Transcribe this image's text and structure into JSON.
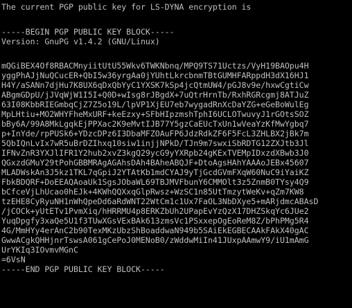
{
  "console": {
    "heading": "The current PGP public key for LS-DYNA encryption is",
    "begin_marker": "-----BEGIN PGP PUBLIC KEY BLOCK-----",
    "version": "Version: GnuPG v1.4.2 (GNU/Linux)",
    "key_lines": [
      "mQGiBEX4Of8RBACMnyiitUtU55Wkv6TWKNbnq/MPQ9TS71Uctzs/VyH19BAOpu4H",
      "yggPhAJjNuQCucER+QbI5w36yrgAa0jYUhtLkrcbnmTBtGUMHFARppdH3dX16HJ1",
      "H4Y/aSANn7djHu7K8UX6qDxQbYyC1YXSK7kSp4jcQtmUW4/pGJ8v9e/hxwCgtiCw",
      "ABgmGDpU/jJVqWjW1I5I+Q0D+wIsg8rJBgdX+7uQtrHrnTb/RxhRGRcgmj8ATJuZ",
      "63I08KbbRIEGmbqCjZ7Z5o19L/lpVP1XjEU7eb7wygadRnXcDaYZG+eGeBoWulEg",
      "MpLHtiu+MO2WHYFheMxURF+keEzxy+SFbHIpzmshTphI6UCLOTwuvyJ1rGOtsSOZ",
      "bBy6A/99A8MkLgqkEjPPXac2K9eMvtIJB77Y5gzCaEUcTxUn1wVeaYzKfMwYgbq7",
      "p+InYde/rpPUSk6+YDzcDPz6I3DbaMFZOAuFP6JdzRdkZF6F5FcL3ZHLBX2jBk7m",
      "5QbIQnLvIx7wR5uBrDZIhxq10siw1injjNPkD/TJn9m7swxiSbRDTG12ZXJtb3Jl",
      "IFNvZnR3YXJlIFR1Y2hub2xvZ3kgQ29ycG9yYXRpb24gKExTVEMpIDxzdXBwb3J0",
      "QGxzdGMuY29tPohGBBMRAgAGAhsDAh4BAheABQJF+DtoAgsHAhYAAAoJEBx45607",
      "MLADWskAn3J5kz1TKL7qGpiJ2YTAtKb1mdCYAJ9yTjGcdGVmFXqW60NuC9iYaiKZ",
      "FbkBDQRF+DoEEAQAoaUk1SgsJObaWL69TBJMVFbunY6CMMOlt3z5ZnmB0TYsy4Q9",
      "bCfceVjLhUcao0hEJk+4KWhQQXxqGlpRwsz+WzSC1n85UtTmzytWeKv+qZm7KW8",
      "tzEHE8CyRyuNH1nWhQpeDd6aRdWNT22WtCm1c1Ux7FaOL3NbDXye5+mARjdmcABAsD",
      "/jCOCk+yUtETv1PvmXiq/hHRRMU4p8ERKZbUh2UPapEvYzQzX17DHZSkqYc6JUe2",
      "YuqDpgfy3xaQe5U1f3TUwXGsVExBAk613zmsVc1PSxxepOgEoReM8Z/bPhPMg5R4",
      "4G/MmHYy4erAnC2b90TexMKzUbzShBoaddwaN949b5SAiEkEGBECAAkFAkX40gAC",
      "GwwACgkQHHjnrTswsA061gCePoJ0MENoB0/zWddwMiIn41JUxpAAmwY9/iU1mAmG",
      "UrYKIq3IOvmvMGnC",
      "=6VsN"
    ],
    "end_marker": "-----END PGP PUBLIC KEY BLOCK-----"
  }
}
